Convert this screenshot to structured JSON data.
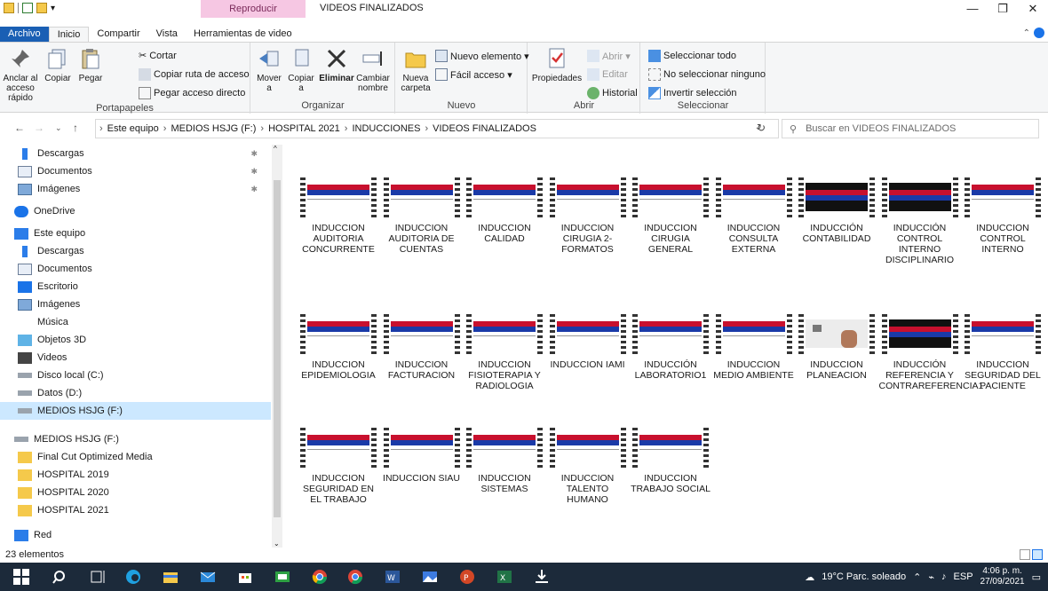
{
  "titlebar": {
    "context_tab": "Reproducir",
    "title": "VIDEOS FINALIZADOS",
    "minimize": "—",
    "maximize": "❐",
    "close": "✕"
  },
  "tabs": [
    {
      "label": "Archivo"
    },
    {
      "label": "Inicio"
    },
    {
      "label": "Compartir"
    },
    {
      "label": "Vista"
    },
    {
      "label": "Herramientas de video"
    }
  ],
  "ribbon": {
    "portapapeles": {
      "group_label": "Portapapeles",
      "anclar": "Anclar al acceso rápido",
      "copiar": "Copiar",
      "pegar": "Pegar",
      "cortar": "Cortar",
      "copiar_ruta": "Copiar ruta de acceso",
      "pegar_acceso": "Pegar acceso directo"
    },
    "organizar": {
      "group_label": "Organizar",
      "mover": "Mover a",
      "copiar_a": "Copiar a",
      "eliminar": "Eliminar",
      "cambiar": "Cambiar nombre"
    },
    "nuevo": {
      "group_label": "Nuevo",
      "nueva_carpeta": "Nueva carpeta",
      "nuevo_elemento": "Nuevo elemento ▾",
      "facil_acceso": "Fácil acceso ▾"
    },
    "abrir": {
      "group_label": "Abrir",
      "propiedades": "Propiedades",
      "abrir": "Abrir ▾",
      "editar": "Editar",
      "historial": "Historial"
    },
    "seleccionar": {
      "group_label": "Seleccionar",
      "todo": "Seleccionar todo",
      "ninguno": "No seleccionar ninguno",
      "invertir": "Invertir selección"
    }
  },
  "address": {
    "crumbs": [
      "Este equipo",
      "MEDIOS HSJG (F:)",
      "HOSPITAL 2021",
      "INDUCCIONES",
      "VIDEOS FINALIZADOS"
    ],
    "search_placeholder": "Buscar en VIDEOS FINALIZADOS"
  },
  "nav": [
    {
      "label": "Descargas",
      "icon": "download-icon",
      "pinned": true
    },
    {
      "label": "Documentos",
      "icon": "document-icon",
      "pinned": true
    },
    {
      "label": "Imágenes",
      "icon": "pictures-icon",
      "pinned": true
    },
    {
      "label": "OneDrive",
      "icon": "cloud-icon",
      "pinned": false
    },
    {
      "label": "Este equipo",
      "icon": "computer-icon",
      "pinned": false
    },
    {
      "label": "Descargas",
      "icon": "download-icon",
      "pinned": false
    },
    {
      "label": "Documentos",
      "icon": "document-icon",
      "pinned": false
    },
    {
      "label": "Escritorio",
      "icon": "desktop-icon",
      "pinned": false
    },
    {
      "label": "Imágenes",
      "icon": "pictures-icon",
      "pinned": false
    },
    {
      "label": "Música",
      "icon": "music-icon",
      "pinned": false
    },
    {
      "label": "Objetos 3D",
      "icon": "cube-icon",
      "pinned": false
    },
    {
      "label": "Videos",
      "icon": "video-icon",
      "pinned": false
    },
    {
      "label": "Disco local (C:)",
      "icon": "drive-icon",
      "pinned": false
    },
    {
      "label": "Datos (D:)",
      "icon": "drive-icon",
      "pinned": false
    },
    {
      "label": "MEDIOS HSJG (F:)",
      "icon": "drive-icon",
      "pinned": false,
      "selected": true
    },
    {
      "label": "MEDIOS HSJG (F:)",
      "icon": "drive-icon",
      "pinned": false
    },
    {
      "label": "Final Cut Optimized Media",
      "icon": "folder-icon",
      "pinned": false
    },
    {
      "label": "HOSPITAL 2019",
      "icon": "folder-icon",
      "pinned": false
    },
    {
      "label": "HOSPITAL 2020",
      "icon": "folder-icon",
      "pinned": false
    },
    {
      "label": "HOSPITAL 2021",
      "icon": "folder-icon",
      "pinned": false
    },
    {
      "label": "Red",
      "icon": "network-icon",
      "pinned": false
    }
  ],
  "files": [
    {
      "name": "INDUCCION AUDITORIA CONCURRENTE",
      "style": "light"
    },
    {
      "name": "INDUCCION AUDITORIA DE CUENTAS",
      "style": "light"
    },
    {
      "name": "INDUCCION CALIDAD",
      "style": "light"
    },
    {
      "name": "INDUCCION CIRUGIA 2-FORMATOS",
      "style": "light"
    },
    {
      "name": "INDUCCION CIRUGIA GENERAL",
      "style": "light"
    },
    {
      "name": "INDUCCION CONSULTA EXTERNA",
      "style": "light"
    },
    {
      "name": "INDUCCIÓN CONTABILIDAD",
      "style": "dark"
    },
    {
      "name": "INDUCCIÓN CONTROL INTERNO DISCIPLINARIO",
      "style": "dark"
    },
    {
      "name": "INDUCCION CONTROL INTERNO",
      "style": "light"
    },
    {
      "name": "INDUCCION EPIDEMIOLOGIA",
      "style": "light"
    },
    {
      "name": "INDUCCION FACTURACION",
      "style": "light"
    },
    {
      "name": "INDUCCION FISIOTERAPIA Y RADIOLOGIA",
      "style": "light"
    },
    {
      "name": "INDUCCION IAMI",
      "style": "light"
    },
    {
      "name": "INDUCCIÓN LABORATORIO1",
      "style": "light"
    },
    {
      "name": "INDUCCION MEDIO AMBIENTE",
      "style": "light"
    },
    {
      "name": "INDUCCION PLANEACION",
      "style": "photo"
    },
    {
      "name": "INDUCCIÓN REFERENCIA Y CONTRAREFERENCIA1",
      "style": "dark"
    },
    {
      "name": "INDUCCION SEGURIDAD DEL PACIENTE",
      "style": "light"
    },
    {
      "name": "INDUCCION SEGURIDAD EN EL TRABAJO",
      "style": "light"
    },
    {
      "name": "INDUCCION SIAU",
      "style": "light"
    },
    {
      "name": "INDUCCION SISTEMAS",
      "style": "light"
    },
    {
      "name": "INDUCCION TALENTO HUMANO",
      "style": "light"
    },
    {
      "name": "INDUCCION TRABAJO SOCIAL",
      "style": "light"
    }
  ],
  "status": {
    "count": "23 elementos"
  },
  "tray": {
    "weather": "19°C  Parc. soleado",
    "lang": "ESP",
    "time": "4:06 p. m.",
    "date": "27/09/2021"
  },
  "colors": {
    "accent": "#1a5fb4",
    "selection": "#cce8ff",
    "context_tab": "#f6c7e3",
    "taskbar": "#1c2a3a"
  }
}
